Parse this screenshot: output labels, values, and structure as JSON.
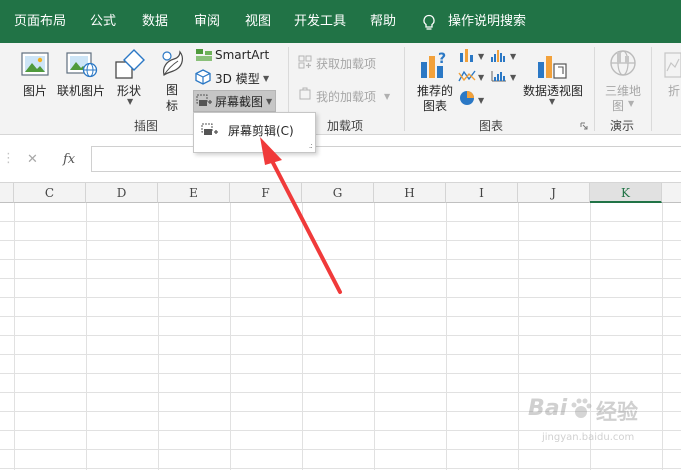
{
  "tabs": [
    {
      "label": "页面布局"
    },
    {
      "label": "公式"
    },
    {
      "label": "数据"
    },
    {
      "label": "审阅"
    },
    {
      "label": "视图"
    },
    {
      "label": "开发工具"
    },
    {
      "label": "帮助"
    }
  ],
  "tell_me": "操作说明搜索",
  "ribbon": {
    "illustrations": {
      "group_label": "插图",
      "pictures": "图片",
      "online_pictures": "联机图片",
      "shapes": "形状",
      "icons_line1": "图",
      "icons_line2": "标",
      "smartart": "SmartArt",
      "models3d": "3D 模型",
      "screenshot": "屏幕截图"
    },
    "addins": {
      "group_label": "加载项",
      "get_addins": "获取加载项",
      "my_addins": "我的加载项"
    },
    "charts": {
      "group_label": "图表",
      "recommended_line1": "推荐的",
      "recommended_line2": "图表",
      "pivot_chart": "数据透视图"
    },
    "tours": {
      "group_label": "演示",
      "map3d_line1": "三维地",
      "map3d_line2": "图"
    },
    "sparklines_partial": "折"
  },
  "dropdown": {
    "item_label": "屏幕剪辑(C)"
  },
  "formula_bar": {
    "cancel_glyph": "✕",
    "enter_glyph": "✓",
    "fx_label": "fx",
    "value": ""
  },
  "columns": [
    "C",
    "D",
    "E",
    "F",
    "G",
    "H",
    "I",
    "J",
    "K"
  ],
  "selected_column": "K",
  "watermark": {
    "line1": "Bai",
    "line2": "经验",
    "line3": "jingyan.baidu.com"
  },
  "colors": {
    "accent": "#217346",
    "arrow": "#f03a3a"
  }
}
